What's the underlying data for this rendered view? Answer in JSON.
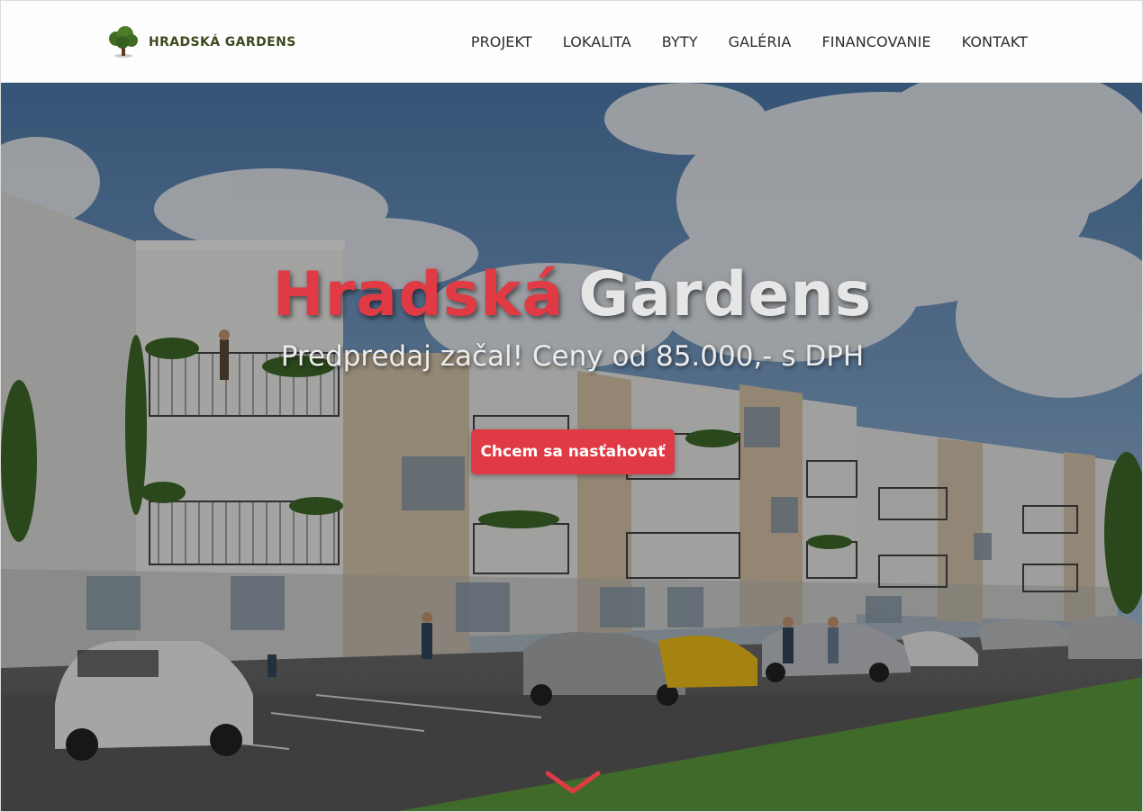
{
  "brand": {
    "name": "HRADSKÁ GARDENS",
    "logo_icon": "tree-icon",
    "logo_color": "#3f6b22"
  },
  "nav": {
    "items": [
      {
        "label": "PROJEKT"
      },
      {
        "label": "LOKALITA"
      },
      {
        "label": "BYTY"
      },
      {
        "label": "GALÉRIA"
      },
      {
        "label": "FINANCOVANIE"
      },
      {
        "label": "KONTAKT"
      }
    ]
  },
  "hero": {
    "title_part1": "Hradská",
    "title_part2": "Gardens",
    "subtitle": "Predpredaj začal! Ceny od 85.000,- s DPH",
    "cta_label": "Chcem sa nasťahovať",
    "scroll_icon": "chevron-down-icon",
    "background_image": "apartment-building-rendering",
    "accent_color": "#e03a45"
  }
}
